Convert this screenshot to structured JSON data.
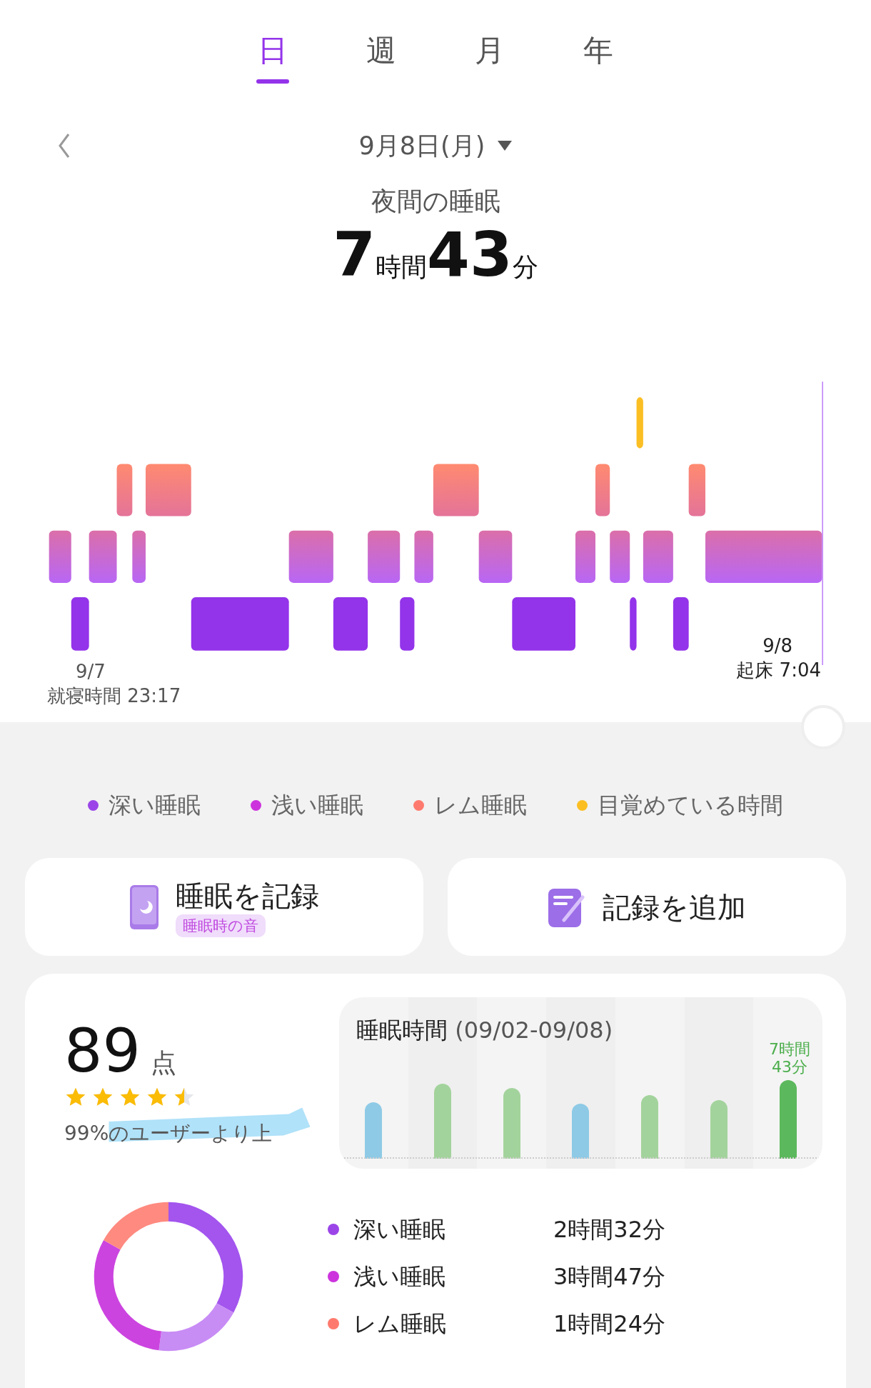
{
  "tabs": [
    {
      "label": "日",
      "selected": true
    },
    {
      "label": "週",
      "selected": false
    },
    {
      "label": "月",
      "selected": false
    },
    {
      "label": "年",
      "selected": false
    }
  ],
  "date": {
    "label": "9月8日(月)"
  },
  "summary": {
    "title": "夜間の睡眠",
    "hours": "7",
    "hours_unit": "時間",
    "minutes": "43",
    "minutes_unit": "分"
  },
  "hypnogram": {
    "start_date": "9/7",
    "start_label": "就寝時間 23:17",
    "end_date": "9/8",
    "end_label": "起床 7:04"
  },
  "legend": [
    {
      "label": "深い睡眠",
      "color": "#9b45e8"
    },
    {
      "label": "浅い睡眠",
      "color": "#cc33dd"
    },
    {
      "label": "レム睡眠",
      "color": "#ff7a6e"
    },
    {
      "label": "目覚めている時間",
      "color": "#fbbf24"
    }
  ],
  "actions": [
    {
      "kind": "record",
      "label": "睡眠を記録",
      "badge": "睡眠時の音"
    },
    {
      "kind": "add",
      "label": "記録を追加"
    }
  ],
  "score": {
    "value": "89",
    "unit": "点",
    "stars": 4.5,
    "comparison": "99%のユーザーより上"
  },
  "weekly": {
    "title": "睡眠時間",
    "range": "(09/02-09/08)",
    "latest_line_1": "7時間",
    "latest_line_2": "43分"
  },
  "breakdown": [
    {
      "label": "深い睡眠",
      "value": "2時間32分",
      "color": "#9b45e8"
    },
    {
      "label": "浅い睡眠",
      "value": "3時間47分",
      "color": "#cc33dd"
    },
    {
      "label": "レム睡眠",
      "value": "1時間24分",
      "color": "#ff7a6e"
    }
  ]
}
